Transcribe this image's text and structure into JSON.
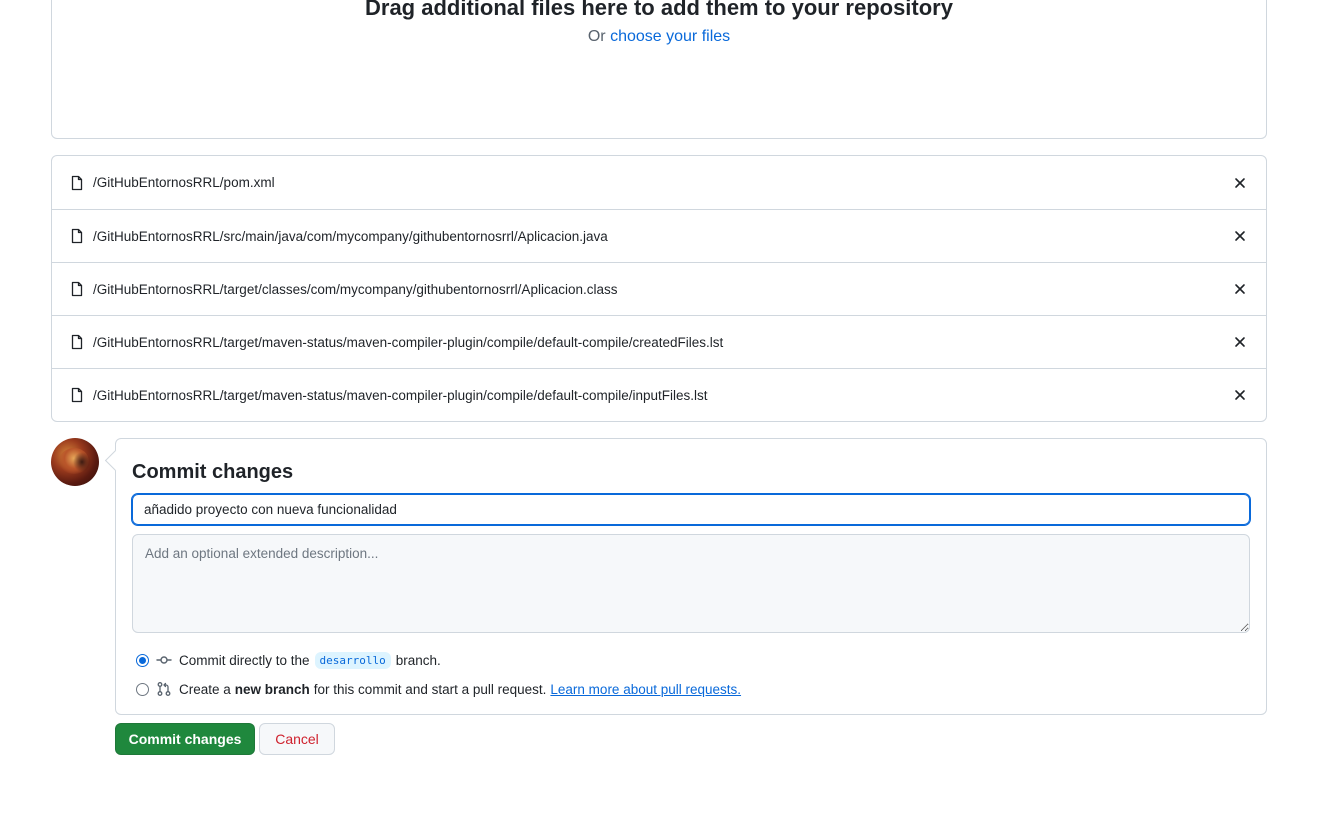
{
  "dropzone": {
    "title": "Drag additional files here to add them to your repository",
    "or_text": "Or",
    "choose_link": "choose your files"
  },
  "files": [
    {
      "path": "/GitHubEntornosRRL/pom.xml"
    },
    {
      "path": "/GitHubEntornosRRL/src/main/java/com/mycompany/githubentornosrrl/Aplicacion.java"
    },
    {
      "path": "/GitHubEntornosRRL/target/classes/com/mycompany/githubentornosrrl/Aplicacion.class"
    },
    {
      "path": "/GitHubEntornosRRL/target/maven-status/maven-compiler-plugin/compile/default-compile/createdFiles.lst"
    },
    {
      "path": "/GitHubEntornosRRL/target/maven-status/maven-compiler-plugin/compile/default-compile/inputFiles.lst"
    }
  ],
  "commit": {
    "title": "Commit changes",
    "summary_value": "añadido proyecto con nueva funcionalidad",
    "description_placeholder": "Add an optional extended description...",
    "option_direct": {
      "prefix": "Commit directly to the",
      "branch": "desarrollo",
      "suffix": "branch."
    },
    "option_new_branch": {
      "prefix": "Create a",
      "bold": "new branch",
      "suffix": "for this commit and start a pull request.",
      "link": "Learn more about pull requests."
    }
  },
  "buttons": {
    "commit": "Commit changes",
    "cancel": "Cancel"
  },
  "colors": {
    "accent": "#0969da",
    "commit_button": "#1f883d",
    "cancel_text": "#cf222e",
    "border": "#d0d7de"
  }
}
